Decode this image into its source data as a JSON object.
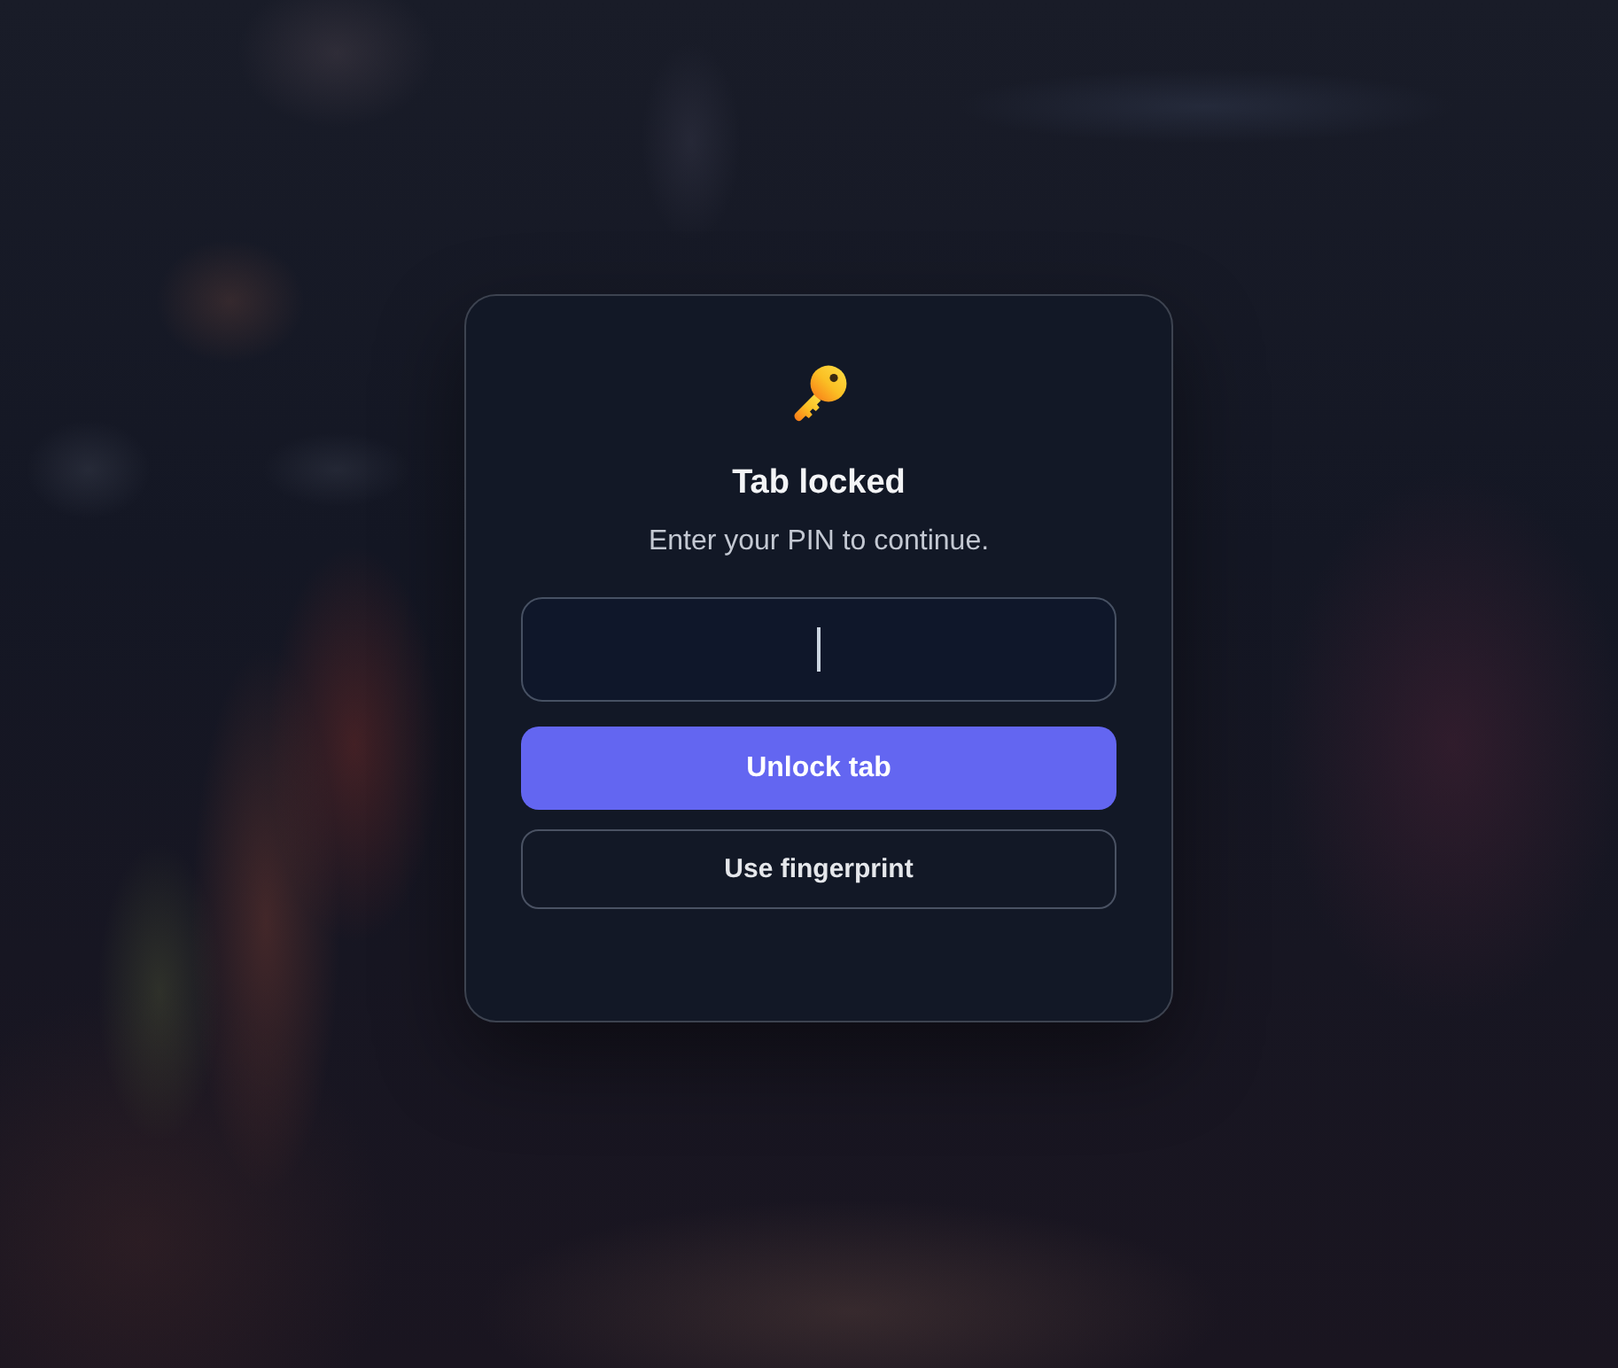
{
  "lock_dialog": {
    "title": "Tab locked",
    "message": "Enter your PIN to continue.",
    "pin_field": {
      "focused": true
    },
    "buttons": [
      {
        "label": "Unlock tab",
        "kind": "primary"
      },
      {
        "label": "Use fingerprint",
        "kind": "secondary"
      }
    ]
  }
}
